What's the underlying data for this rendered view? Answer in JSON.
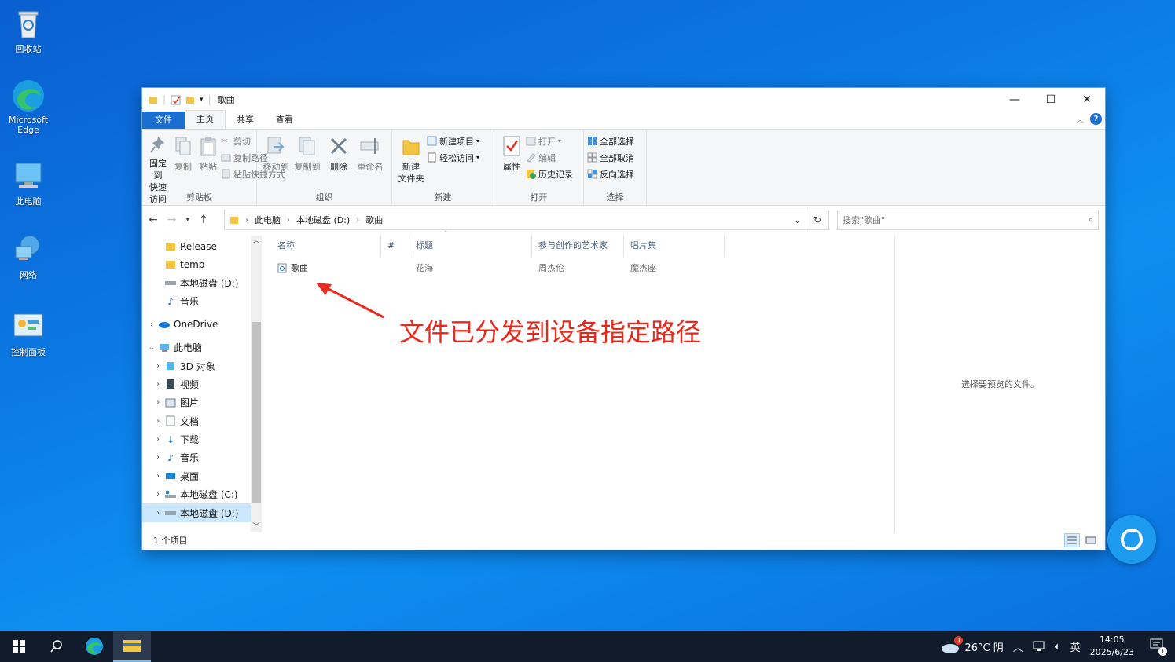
{
  "desktop": {
    "icons": [
      {
        "label": "回收站"
      },
      {
        "label": "Microsoft Edge"
      },
      {
        "label": "此电脑"
      },
      {
        "label": "网络"
      },
      {
        "label": "控制面板"
      }
    ]
  },
  "window": {
    "title": "歌曲",
    "controls": {
      "minimize": "—",
      "maximize": "☐",
      "close": "✕"
    },
    "tabs": [
      "文件",
      "主页",
      "共享",
      "查看"
    ],
    "help": "?"
  },
  "ribbon": {
    "clipboard": {
      "label": "剪贴板",
      "pin": "固定到\n快速访问",
      "pin_l1": "固定到",
      "pin_l2": "快速访问",
      "copy": "复制",
      "paste": "粘贴",
      "cut": "剪切",
      "copy_path": "复制路径",
      "paste_shortcut": "粘贴快捷方式"
    },
    "organize": {
      "label": "组织",
      "move_to": "移动到",
      "copy_to": "复制到",
      "delete": "删除",
      "rename": "重命名"
    },
    "new": {
      "label": "新建",
      "new_folder_l1": "新建",
      "new_folder_l2": "文件夹",
      "new_item": "新建项目",
      "easy_access": "轻松访问"
    },
    "open": {
      "label": "打开",
      "properties": "属性",
      "open": "打开",
      "edit": "编辑",
      "history": "历史记录"
    },
    "select": {
      "label": "选择",
      "select_all": "全部选择",
      "select_none": "全部取消",
      "invert": "反向选择"
    }
  },
  "address": {
    "crumbs": [
      "此电脑",
      "本地磁盘 (D:)",
      "歌曲"
    ],
    "search_placeholder": "搜索\"歌曲\""
  },
  "navpane": {
    "items": [
      {
        "label": "Release",
        "indent": 1
      },
      {
        "label": "temp",
        "indent": 1
      },
      {
        "label": "本地磁盘 (D:)",
        "indent": 1
      },
      {
        "label": "音乐",
        "indent": 1
      },
      {
        "label": "OneDrive",
        "indent": 0
      },
      {
        "label": "此电脑",
        "indent": 0
      },
      {
        "label": "3D 对象",
        "indent": 1
      },
      {
        "label": "视频",
        "indent": 1
      },
      {
        "label": "图片",
        "indent": 1
      },
      {
        "label": "文档",
        "indent": 1
      },
      {
        "label": "下载",
        "indent": 1
      },
      {
        "label": "音乐",
        "indent": 1
      },
      {
        "label": "桌面",
        "indent": 1
      },
      {
        "label": "本地磁盘 (C:)",
        "indent": 1
      },
      {
        "label": "本地磁盘 (D:)",
        "indent": 1
      }
    ]
  },
  "files": {
    "columns": [
      "名称",
      "#",
      "标题",
      "参与创作的艺术家",
      "唱片集"
    ],
    "rows": [
      {
        "name": "歌曲",
        "number": "",
        "title": "花海",
        "artist": "周杰伦",
        "album": "魔杰座"
      }
    ]
  },
  "preview": {
    "text": "选择要预览的文件。"
  },
  "status": {
    "count": "1 个项目"
  },
  "annotation": {
    "text": "文件已分发到设备指定路径"
  },
  "taskbar": {
    "weather": "26°C 阴",
    "weather_badge": "1",
    "ime": "英",
    "time": "14:05",
    "date": "2025/6/23",
    "notif_badge": "1"
  }
}
